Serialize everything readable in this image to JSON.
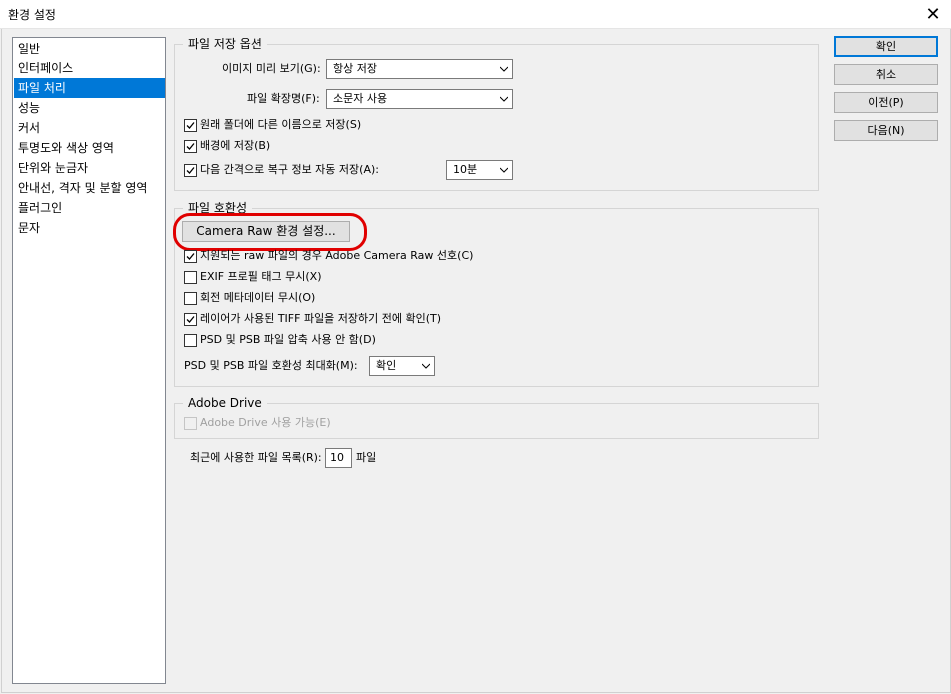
{
  "window": {
    "title": "환경 설정",
    "close_glyph": "✕"
  },
  "sidebar": {
    "items": [
      {
        "label": "일반"
      },
      {
        "label": "인터페이스"
      },
      {
        "label": "파일 처리",
        "selected": true
      },
      {
        "label": "성능"
      },
      {
        "label": "커서"
      },
      {
        "label": "투명도와 색상 영역"
      },
      {
        "label": "단위와 눈금자"
      },
      {
        "label": "안내선, 격자 및 분할 영역"
      },
      {
        "label": "플러그인"
      },
      {
        "label": "문자"
      }
    ]
  },
  "file_save_options": {
    "title": "파일 저장 옵션",
    "image_preview_label": "이미지 미리 보기(G):",
    "image_preview_value": "항상 저장",
    "file_extension_label": "파일 확장명(F):",
    "file_extension_value": "소문자 사용",
    "save_as_original_folder": {
      "label": "원래 폴더에 다른 이름으로 저장(S)",
      "checked": true
    },
    "save_in_background": {
      "label": "배경에 저장(B)",
      "checked": true
    },
    "auto_save": {
      "label": "다음 간격으로 복구 정보 자동 저장(A):",
      "checked": true
    },
    "auto_save_interval": "10분"
  },
  "file_compatibility": {
    "title": "파일 호환성",
    "camera_raw_button": "Camera Raw 환경 설정...",
    "prefer_camera_raw": {
      "label": "지원되는 raw 파일의 경우 Adobe Camera Raw 선호(C)",
      "checked": true
    },
    "ignore_exif": {
      "label": "EXIF 프로필 태그 무시(X)",
      "checked": false
    },
    "ignore_rotation": {
      "label": "회전 메타데이터 무시(O)",
      "checked": false
    },
    "ask_layered_tiff": {
      "label": "레이어가 사용된 TIFF 파일을 저장하기 전에 확인(T)",
      "checked": true
    },
    "disable_compression": {
      "label": "PSD 및 PSB 파일 압축 사용 안 함(D)",
      "checked": false
    },
    "maximize_label": "PSD 및 PSB 파일 호환성 최대화(M):",
    "maximize_value": "확인"
  },
  "adobe_drive": {
    "title": "Adobe Drive",
    "enable": {
      "label": "Adobe Drive 사용 가능(E)",
      "checked": false,
      "disabled": true
    }
  },
  "recent_files": {
    "label": "최근에 사용한 파일 목록(R):",
    "value": "10",
    "unit": "파일"
  },
  "buttons": {
    "ok": "확인",
    "cancel": "취소",
    "prev": "이전(P)",
    "next": "다음(N)"
  },
  "colors": {
    "accent": "#0078d7",
    "highlight_ring": "#e00000"
  }
}
